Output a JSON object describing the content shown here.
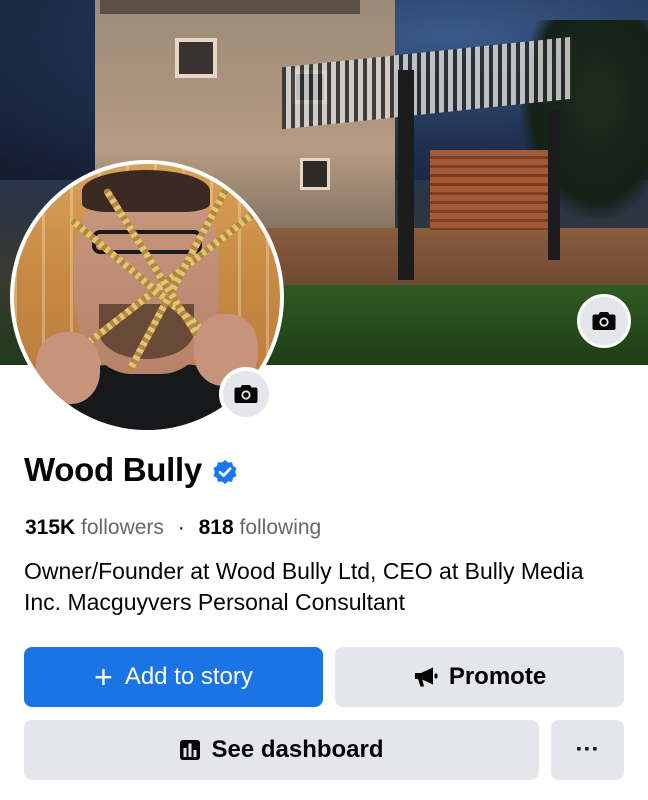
{
  "profile": {
    "name": "Wood Bully",
    "verified_icon": "verified-badge-icon",
    "followers_count": "315K",
    "followers_label": "followers",
    "separator": "·",
    "following_count": "818",
    "following_label": "following",
    "bio": "Owner/Founder at Wood Bully Ltd, CEO at Bully Media Inc. Macguyvers Personal Consultant"
  },
  "actions": {
    "add_story_icon": "+",
    "add_story_label": "Add to story",
    "promote_label": "Promote",
    "dashboard_label": "See dashboard",
    "more_label": "···"
  },
  "colors": {
    "primary": "#1b74e4",
    "secondary_button": "#e4e6eb",
    "verified": "#1877f2"
  },
  "icons": {
    "cover_camera": "camera-icon",
    "avatar_camera": "camera-icon",
    "promote": "megaphone-icon",
    "dashboard": "bar-chart-icon"
  }
}
